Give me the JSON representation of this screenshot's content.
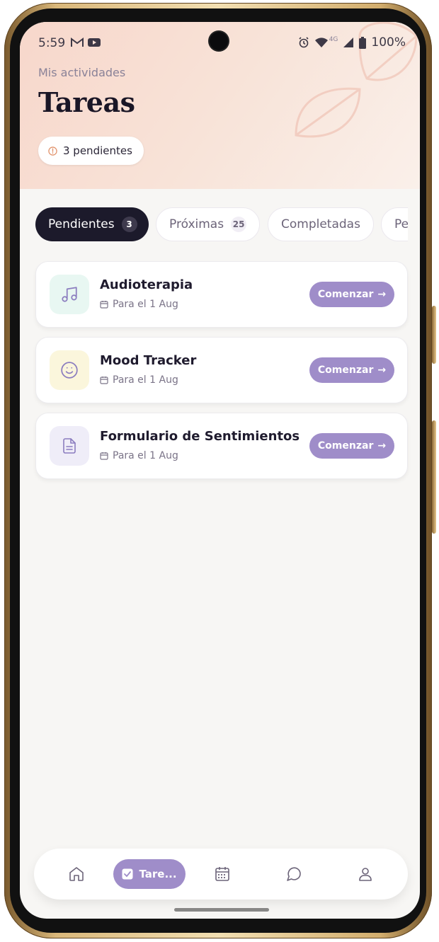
{
  "status_bar": {
    "time": "5:59",
    "battery": "100%",
    "network": "4G"
  },
  "header": {
    "eyebrow": "Mis actividades",
    "title": "Tareas",
    "pending_chip": "3 pendientes"
  },
  "tabs": [
    {
      "label": "Pendientes",
      "count": "3",
      "active": true
    },
    {
      "label": "Próximas",
      "count": "25",
      "active": false
    },
    {
      "label": "Completadas",
      "count": "",
      "active": false
    },
    {
      "label": "Pe",
      "count": "",
      "active": false
    }
  ],
  "tasks": [
    {
      "title": "Audioterapia",
      "due": "Para el 1 Aug",
      "action": "Comenzar",
      "icon": "music-note-icon",
      "icon_bg": "#e8f7f2"
    },
    {
      "title": "Mood Tracker",
      "due": "Para el 1 Aug",
      "action": "Comenzar",
      "icon": "smiley-icon",
      "icon_bg": "#fbf6dc"
    },
    {
      "title": "Formulario de Sentimientos",
      "due": "Para el 1 Aug",
      "action": "Comenzar",
      "icon": "document-icon",
      "icon_bg": "#efedf8"
    }
  ],
  "bottom_nav": {
    "active_label": "Tare...",
    "items": [
      "home-icon",
      "tasks-icon",
      "calendar-icon",
      "chat-icon",
      "profile-icon"
    ]
  },
  "colors": {
    "accent": "#9f8dc9",
    "dark_tab": "#1c1a2b",
    "header_gradient_start": "#f7d7cb"
  }
}
